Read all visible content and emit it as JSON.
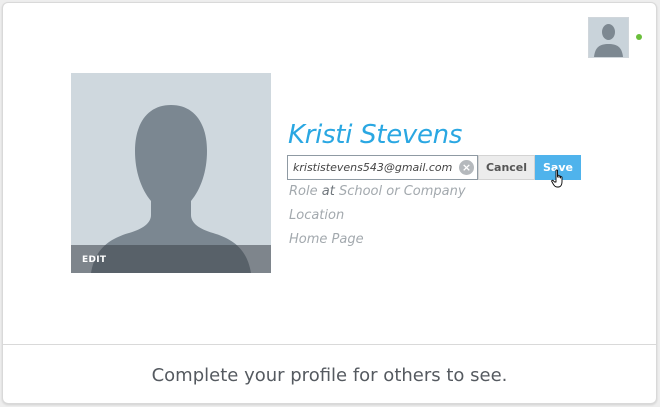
{
  "header": {
    "avatar_icon": "user-avatar-icon",
    "status": "online",
    "status_color": "#6abf3b"
  },
  "profile_photo": {
    "icon": "person-silhouette-icon",
    "edit_label": "EDIT"
  },
  "profile": {
    "name": "Kristi Stevens",
    "name_color": "#2aa7e2"
  },
  "email_editor": {
    "value": "krististevens543@gmail.com",
    "clear_icon": "clear-icon",
    "cancel_label": "Cancel",
    "save_label": "Save",
    "save_color": "#4fb3ec"
  },
  "fields": {
    "role": "Role",
    "at": "at",
    "school_or_company": "School or Company",
    "location": "Location",
    "home_page": "Home Page"
  },
  "footer": {
    "message": "Complete your profile for others to see."
  }
}
